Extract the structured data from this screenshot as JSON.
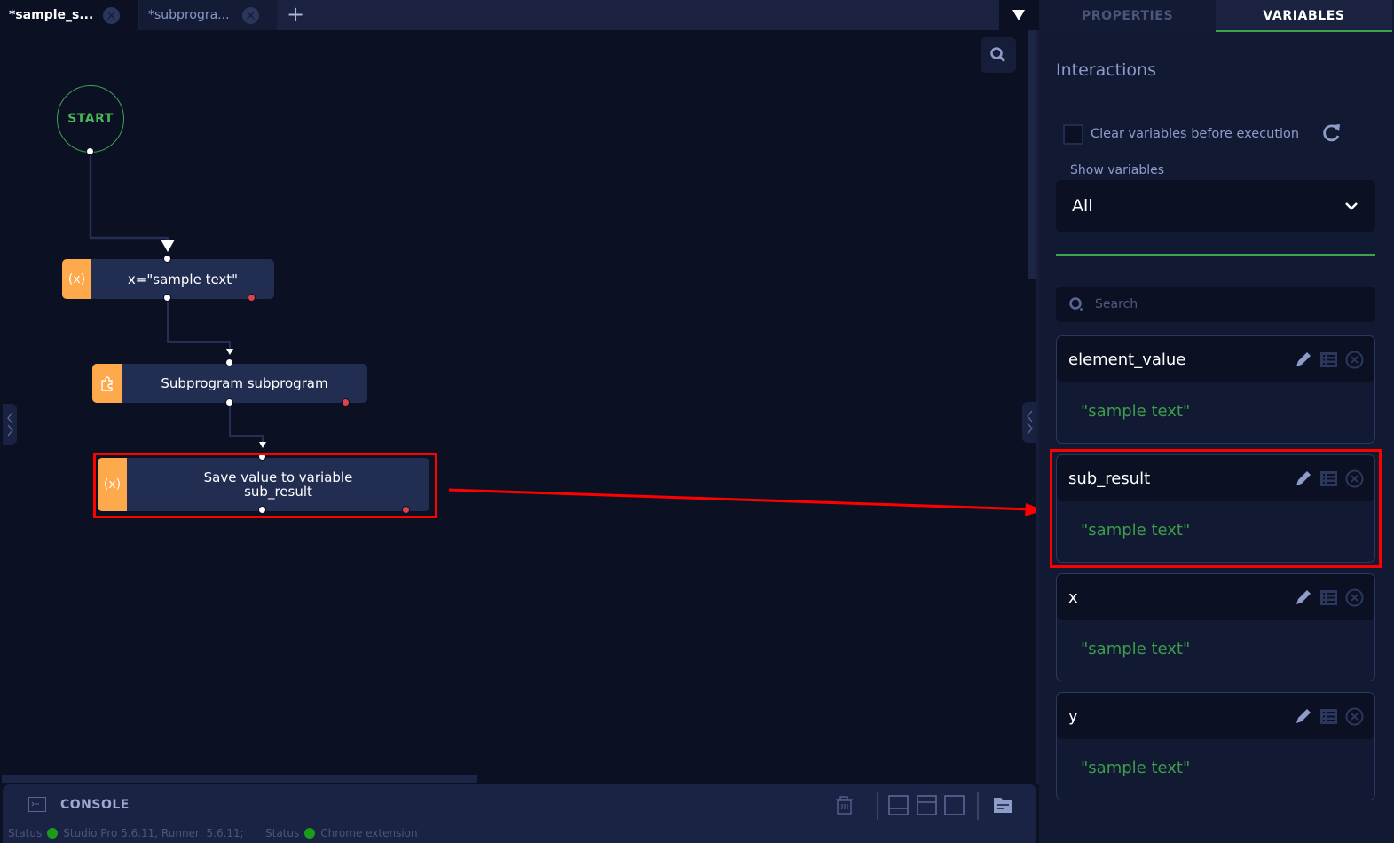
{
  "tabs": [
    {
      "label": "*sample_s...",
      "active": true
    },
    {
      "label": "*subprogra...",
      "active": false
    }
  ],
  "tab_bar": {
    "add_label": "+",
    "dropdown_icon": "triangle-down-icon"
  },
  "canvas": {
    "start_label": "START",
    "nodes": [
      {
        "icon_text": "(x)",
        "icon": "variable-icon",
        "label": "x=\"sample text\""
      },
      {
        "icon": "puzzle-icon",
        "label": "Subprogram subprogram"
      },
      {
        "icon_text": "(x)",
        "icon": "variable-icon",
        "label_line1": "Save value to variable",
        "label_line2": "sub_result",
        "highlighted": true
      }
    ]
  },
  "panel": {
    "tabs": {
      "properties": "PROPERTIES",
      "variables": "VARIABLES"
    },
    "active_tab": "VARIABLES",
    "section_title": "Interactions",
    "clear_checkbox_label": "Clear variables before execution",
    "clear_checked": false,
    "show_variables_label": "Show variables",
    "show_variables_value": "All",
    "search_placeholder": "Search",
    "variables": [
      {
        "name": "element_value",
        "value": "\"sample text\"",
        "highlighted": false
      },
      {
        "name": "sub_result",
        "value": "\"sample text\"",
        "highlighted": true
      },
      {
        "name": "x",
        "value": "\"sample text\"",
        "highlighted": false
      },
      {
        "name": "y",
        "value": "\"sample text\"",
        "highlighted": false
      }
    ]
  },
  "console": {
    "label": "CONSOLE",
    "status": [
      {
        "label": "Status",
        "text": "Studio Pro 5.6.11, Runner: 5.6.11;",
        "color": "#1b9a1b"
      },
      {
        "label": "Status",
        "text": "Chrome extension",
        "color": "#1b9a1b"
      }
    ]
  },
  "colors": {
    "accent_green": "#3fa34d",
    "node_icon_orange": "#ffa94d",
    "error_port": "#e0414f",
    "highlight_red": "#ff0000",
    "value_green": "#3d9d4c"
  }
}
